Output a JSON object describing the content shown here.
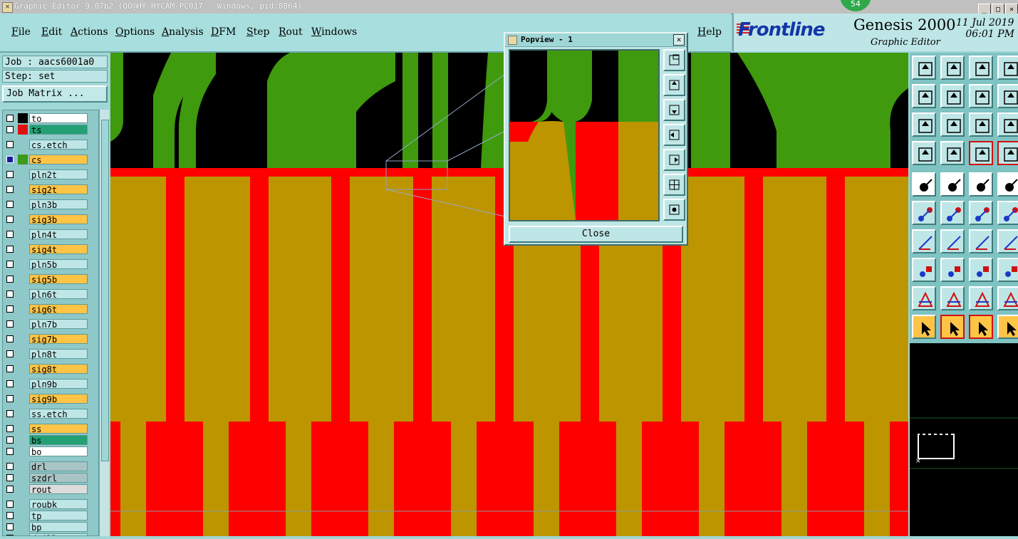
{
  "window": {
    "title": "Graphic Editor 9.07b2 (OO@HY-HYCAM-PC017 - Windows, pid:8864)",
    "badge": "54",
    "controls": [
      "_",
      "□",
      "×"
    ]
  },
  "menu": {
    "items": [
      "File",
      "Edit",
      "Actions",
      "Options",
      "Analysis",
      "DFM",
      "Step",
      "Rout",
      "Windows"
    ],
    "help": "Help"
  },
  "brand": {
    "logo": "Frontline",
    "product": "Genesis 2000",
    "module": "Graphic Editor",
    "date": "11 Jul 2019",
    "time": "06:01 PM"
  },
  "job": {
    "job_label": "Job : aacs6001a0",
    "step_label": "Step: set",
    "matrix_button": "Job Matrix ..."
  },
  "layers": [
    {
      "name": "to",
      "style": "white",
      "color": "#000000"
    },
    {
      "name": "ts",
      "style": "teal",
      "color": "#e01010"
    },
    {
      "name": "cs.etch",
      "style": "light",
      "color": ""
    },
    {
      "name": "cs",
      "style": "orange",
      "color": "#3c9a1c",
      "active": true
    },
    {
      "name": "pln2t",
      "style": "light",
      "color": ""
    },
    {
      "name": "sig2t",
      "style": "orange",
      "color": ""
    },
    {
      "name": "pln3b",
      "style": "light",
      "color": ""
    },
    {
      "name": "sig3b",
      "style": "orange",
      "color": ""
    },
    {
      "name": "pln4t",
      "style": "light",
      "color": ""
    },
    {
      "name": "sig4t",
      "style": "orange",
      "color": ""
    },
    {
      "name": "pln5b",
      "style": "light",
      "color": ""
    },
    {
      "name": "sig5b",
      "style": "orange",
      "color": ""
    },
    {
      "name": "pln6t",
      "style": "light",
      "color": ""
    },
    {
      "name": "sig6t",
      "style": "orange",
      "color": ""
    },
    {
      "name": "pln7b",
      "style": "light",
      "color": ""
    },
    {
      "name": "sig7b",
      "style": "orange",
      "color": ""
    },
    {
      "name": "pln8t",
      "style": "light",
      "color": ""
    },
    {
      "name": "sig8t",
      "style": "orange",
      "color": ""
    },
    {
      "name": "pln9b",
      "style": "light",
      "color": ""
    },
    {
      "name": "sig9b",
      "style": "orange",
      "color": ""
    },
    {
      "name": "ss.etch",
      "style": "light",
      "color": ""
    },
    {
      "name": "ss",
      "style": "orange",
      "color": ""
    },
    {
      "name": "bs",
      "style": "teal",
      "color": ""
    },
    {
      "name": "bo",
      "style": "white",
      "color": ""
    },
    {
      "name": "drl",
      "style": "gray",
      "color": ""
    },
    {
      "name": "szdrl",
      "style": "gray",
      "color": ""
    },
    {
      "name": "rout",
      "style": "lgray",
      "color": ""
    },
    {
      "name": "roubk",
      "style": "light",
      "color": ""
    },
    {
      "name": "tp",
      "style": "light",
      "color": ""
    },
    {
      "name": "bp",
      "style": "light",
      "color": ""
    },
    {
      "name": "drill",
      "style": "light",
      "color": ""
    }
  ],
  "popview": {
    "title": "Popview - 1",
    "close_label": "Close"
  },
  "colors": {
    "copper_green": "#3f9a0e",
    "soldermask_gold": "#bd9500",
    "pad_red": "#ff0000",
    "panel_teal": "#9fd6d6"
  },
  "tools": {
    "rows": [
      [
        "home-icon",
        "down-arrow-icon",
        "house-icon",
        "window-icon"
      ],
      [
        "left-arrow-icon",
        "right-arrow-icon",
        "undo-icon",
        "redo-icon"
      ],
      [
        "zoom-fit-icon",
        "zoom-home-icon",
        "scale-icon",
        "help-icon"
      ],
      [
        "settings-icon",
        "grid-icon",
        "layers-icon",
        "layers-alt-icon"
      ],
      [
        "shape-arrow-icon",
        "shape-select-icon",
        "ruler-icon",
        "pad-icon"
      ],
      [
        "nodes-icon",
        "cross-icon",
        "line-pad-icon",
        "line-pad-alt-icon"
      ],
      [
        "angle-icon",
        "line-icon",
        "arc-icon",
        "text-icon"
      ],
      [
        "pad-tools-icon",
        "slot-icon",
        "measure-icon",
        "group-icon"
      ],
      [
        "triangle-icon",
        "triangle-alt-icon",
        "triangle-ext-icon",
        "triangle-more-icon"
      ],
      [
        "pointer-icon",
        "pointer-box-icon",
        "pointer-sel-icon",
        "route-icon"
      ]
    ]
  }
}
